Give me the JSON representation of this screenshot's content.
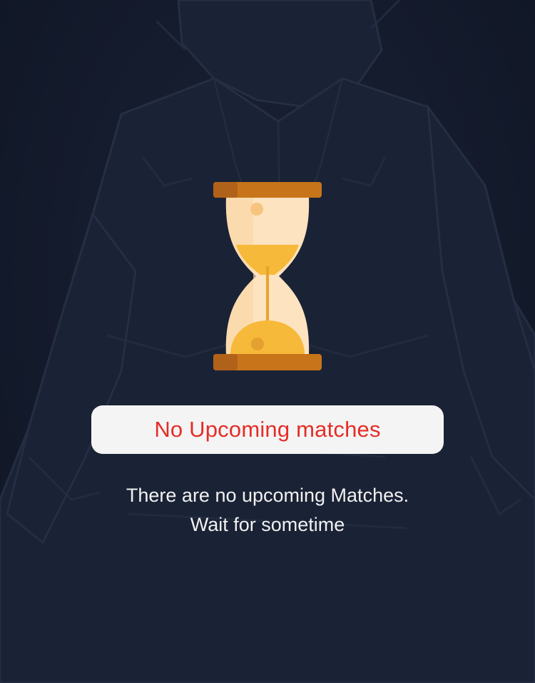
{
  "empty_state": {
    "title": "No Upcoming matches",
    "message_line1": "There are no upcoming Matches.",
    "message_line2": "Wait for sometime",
    "icon": "hourglass-icon"
  },
  "colors": {
    "background": "#121a2b",
    "title_text": "#e52d27",
    "pill_background": "#f4f4f4",
    "message_text": "#f1f1f1",
    "hourglass_frame": "#c8741a",
    "hourglass_sand": "#f6b93a",
    "hourglass_glass": "#fde3bf"
  }
}
